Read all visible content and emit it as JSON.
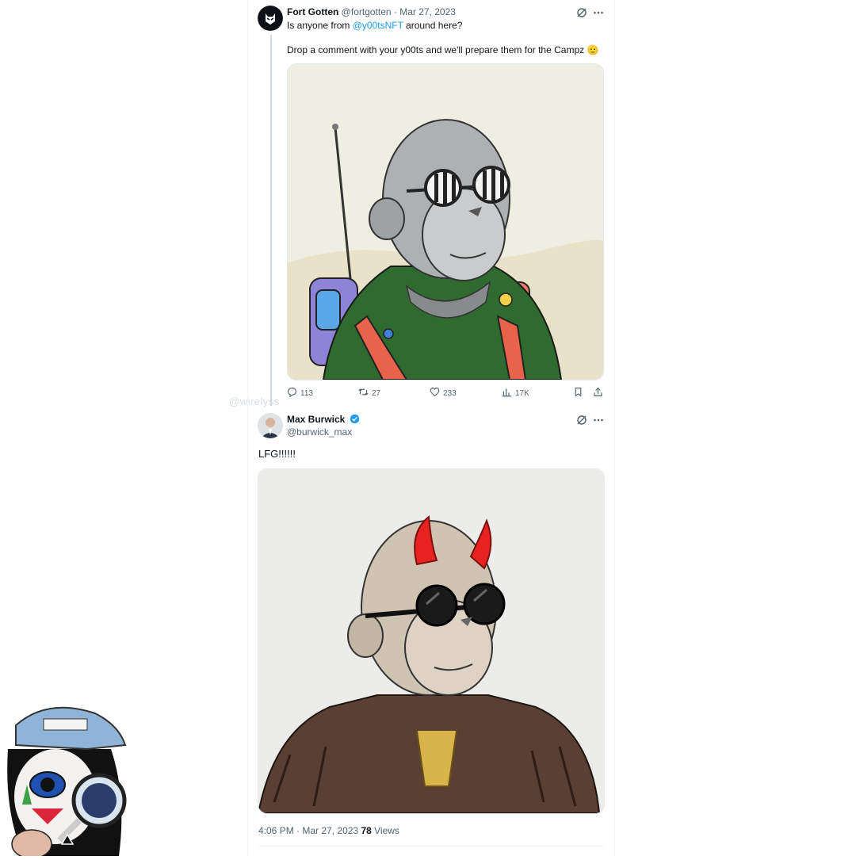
{
  "tweet1": {
    "display_name": "Fort Gotten",
    "handle": "@fortgotten",
    "separator": " · ",
    "date": "Mar 27, 2023",
    "line1_prefix": "Is anyone from ",
    "line1_mention": "@y00tsNFT",
    "line1_suffix": " around here?",
    "line2": "Drop a comment with your y00ts and we'll prepare them for the Campz 🫡",
    "stats": {
      "replies": "113",
      "retweets": "27",
      "likes": "233",
      "views": "17K"
    }
  },
  "watermark": "@wirelyss",
  "tweet2": {
    "display_name": "Max Burwick",
    "handle": "@burwick_max",
    "text": "LFG!!!!!!",
    "time": "4:06 PM",
    "separator": " · ",
    "date": "Mar 27, 2023",
    "views_count": "78",
    "views_label": " Views"
  },
  "colors": {
    "accent": "#1d9bf0",
    "muted_text": "#536471",
    "media1_bg": "#efeee2",
    "media2_bg": "#ececea",
    "hoodie_green": "#2f6b2f"
  },
  "icons": [
    "grok-icon",
    "more-icon",
    "reply-icon",
    "retweet-icon",
    "like-icon",
    "views-icon",
    "bookmark-icon",
    "share-icon",
    "verified-icon"
  ]
}
